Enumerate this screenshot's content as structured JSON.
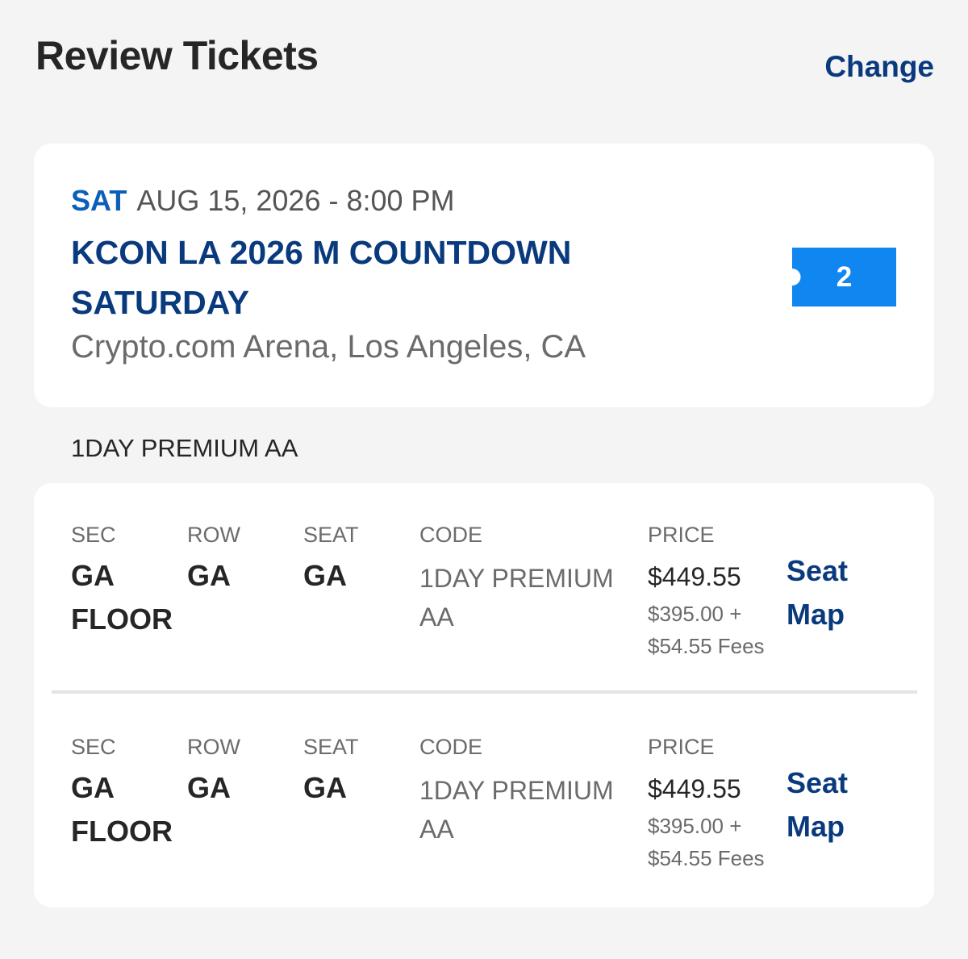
{
  "header": {
    "title": "Review Tickets",
    "change_label": "Change"
  },
  "event": {
    "day": "SAT",
    "date_time": "AUG 15, 2026 - 8:00 PM",
    "name": "KCON LA 2026 M COUNTDOWN SATURDAY",
    "venue": "Crypto.com Arena, Los Angeles, CA",
    "ticket_count": "2"
  },
  "section_label": "1DAY PREMIUM AA",
  "column_labels": {
    "sec": "SEC",
    "row": "ROW",
    "seat": "SEAT",
    "code": "CODE",
    "price": "PRICE"
  },
  "tickets": [
    {
      "sec": "GA FLOOR",
      "row": "GA",
      "seat": "GA",
      "code": "1DAY PREMIUM AA",
      "price": "$449.55",
      "price_breakdown": "$395.00 + $54.55 Fees",
      "seat_map_label": "Seat Map"
    },
    {
      "sec": "GA FLOOR",
      "row": "GA",
      "seat": "GA",
      "code": "1DAY PREMIUM AA",
      "price": "$449.55",
      "price_breakdown": "$395.00 + $54.55 Fees",
      "seat_map_label": "Seat Map"
    }
  ],
  "colors": {
    "background": "#f4f4f4",
    "card": "#ffffff",
    "navy": "#0a3a7e",
    "day_blue": "#0b5fb8",
    "ticket_badge": "#0f86f0",
    "muted_text": "#6b6b6b"
  }
}
